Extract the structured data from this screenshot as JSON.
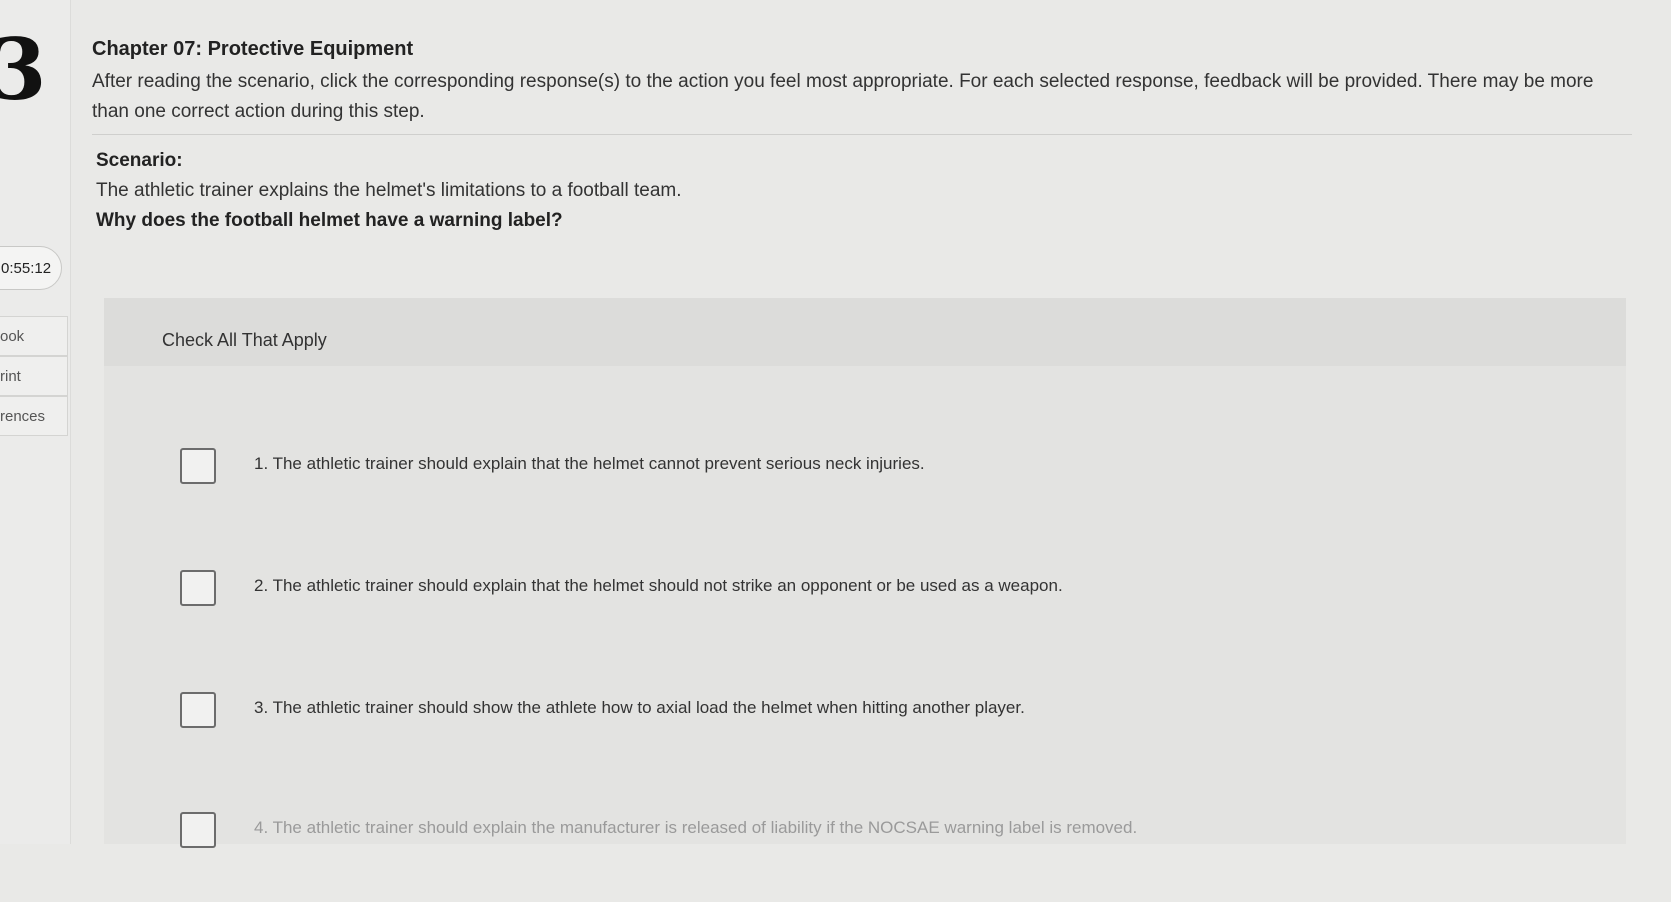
{
  "sidebar": {
    "logo_glyph": "3",
    "timer": "0:55:12",
    "links": [
      {
        "label": "ook"
      },
      {
        "label": "rint"
      },
      {
        "label": "rences"
      }
    ]
  },
  "header": {
    "chapter_title": "Chapter 07: Protective Equipment",
    "instructions": "After reading the scenario, click the corresponding response(s) to the action you feel most appropriate. For each selected response, feedback will be provided. There may be more than one correct action during this step."
  },
  "scenario": {
    "heading": "Scenario:",
    "text": "The athletic trainer explains the helmet's limitations to a football team.",
    "question": "Why does the football helmet have a warning label?"
  },
  "panel": {
    "instruction": "Check All That Apply",
    "options": [
      {
        "text": "1. The athletic trainer should explain that the helmet cannot prevent serious neck injuries."
      },
      {
        "text": "2. The athletic trainer should explain that the helmet should not strike an opponent or be used as a weapon."
      },
      {
        "text": "3. The athletic trainer should show the athlete how to axial load the helmet when hitting another player."
      },
      {
        "text": "4. The athletic trainer should explain the manufacturer is released of liability if the NOCSAE warning label is removed."
      }
    ]
  }
}
